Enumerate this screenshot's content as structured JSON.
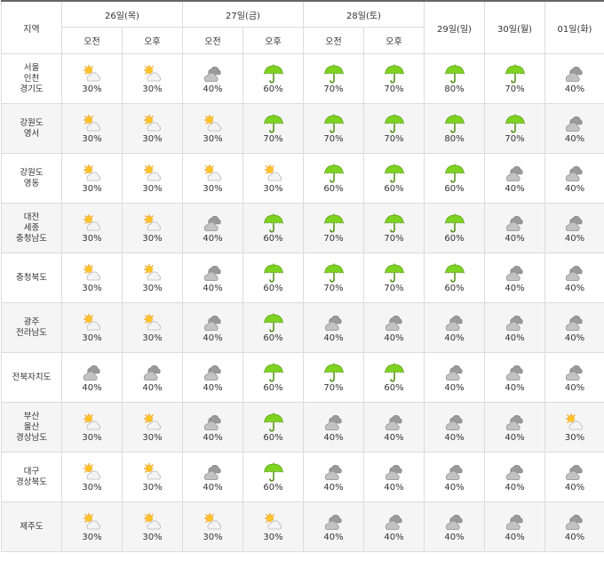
{
  "header": {
    "region_label": "지역",
    "days": [
      "26일(목)",
      "27일(금)",
      "28일(토)",
      "29일(일)",
      "30일(월)",
      "01일(화)"
    ],
    "am_label": "오전",
    "pm_label": "오후"
  },
  "icons": {
    "sunny_cloud": "partly-cloudy-icon",
    "cloudy": "cloudy-icon",
    "rain": "umbrella-rain-icon"
  },
  "rows": [
    {
      "region": [
        "서울",
        "인천",
        "경기도"
      ],
      "cells": [
        [
          "s",
          "30%"
        ],
        [
          "s",
          "30%"
        ],
        [
          "c",
          "40%"
        ],
        [
          "r",
          "60%"
        ],
        [
          "r",
          "70%"
        ],
        [
          "r",
          "70%"
        ],
        [
          "r",
          "80%"
        ],
        [
          "r",
          "70%"
        ],
        [
          "c",
          "40%"
        ]
      ]
    },
    {
      "region": [
        "강원도",
        "영서"
      ],
      "cells": [
        [
          "s",
          "30%"
        ],
        [
          "s",
          "30%"
        ],
        [
          "s",
          "30%"
        ],
        [
          "r",
          "70%"
        ],
        [
          "r",
          "70%"
        ],
        [
          "r",
          "70%"
        ],
        [
          "r",
          "80%"
        ],
        [
          "r",
          "70%"
        ],
        [
          "c",
          "40%"
        ]
      ]
    },
    {
      "region": [
        "강원도",
        "영동"
      ],
      "cells": [
        [
          "s",
          "30%"
        ],
        [
          "s",
          "30%"
        ],
        [
          "s",
          "30%"
        ],
        [
          "s",
          "30%"
        ],
        [
          "r",
          "60%"
        ],
        [
          "r",
          "60%"
        ],
        [
          "r",
          "60%"
        ],
        [
          "c",
          "40%"
        ],
        [
          "c",
          "40%"
        ]
      ]
    },
    {
      "region": [
        "대전",
        "세종",
        "충청남도"
      ],
      "cells": [
        [
          "s",
          "30%"
        ],
        [
          "s",
          "30%"
        ],
        [
          "c",
          "40%"
        ],
        [
          "r",
          "60%"
        ],
        [
          "r",
          "70%"
        ],
        [
          "r",
          "70%"
        ],
        [
          "r",
          "60%"
        ],
        [
          "c",
          "40%"
        ],
        [
          "c",
          "40%"
        ]
      ]
    },
    {
      "region": [
        "충청북도"
      ],
      "cells": [
        [
          "s",
          "30%"
        ],
        [
          "s",
          "30%"
        ],
        [
          "c",
          "40%"
        ],
        [
          "r",
          "60%"
        ],
        [
          "r",
          "70%"
        ],
        [
          "r",
          "70%"
        ],
        [
          "r",
          "60%"
        ],
        [
          "c",
          "40%"
        ],
        [
          "c",
          "40%"
        ]
      ]
    },
    {
      "region": [
        "광주",
        "전라남도"
      ],
      "cells": [
        [
          "s",
          "30%"
        ],
        [
          "s",
          "30%"
        ],
        [
          "c",
          "40%"
        ],
        [
          "r",
          "60%"
        ],
        [
          "c",
          "40%"
        ],
        [
          "c",
          "40%"
        ],
        [
          "c",
          "40%"
        ],
        [
          "c",
          "40%"
        ],
        [
          "c",
          "40%"
        ]
      ]
    },
    {
      "region": [
        "전북자치도"
      ],
      "cells": [
        [
          "c",
          "40%"
        ],
        [
          "c",
          "40%"
        ],
        [
          "c",
          "40%"
        ],
        [
          "r",
          "60%"
        ],
        [
          "r",
          "70%"
        ],
        [
          "r",
          "60%"
        ],
        [
          "c",
          "40%"
        ],
        [
          "c",
          "40%"
        ],
        [
          "c",
          "40%"
        ]
      ]
    },
    {
      "region": [
        "부산",
        "울산",
        "경상남도"
      ],
      "cells": [
        [
          "s",
          "30%"
        ],
        [
          "s",
          "30%"
        ],
        [
          "c",
          "40%"
        ],
        [
          "r",
          "60%"
        ],
        [
          "c",
          "40%"
        ],
        [
          "c",
          "40%"
        ],
        [
          "c",
          "40%"
        ],
        [
          "c",
          "40%"
        ],
        [
          "s",
          "30%"
        ]
      ]
    },
    {
      "region": [
        "대구",
        "경상북도"
      ],
      "cells": [
        [
          "s",
          "30%"
        ],
        [
          "s",
          "30%"
        ],
        [
          "c",
          "40%"
        ],
        [
          "r",
          "60%"
        ],
        [
          "c",
          "40%"
        ],
        [
          "c",
          "40%"
        ],
        [
          "c",
          "40%"
        ],
        [
          "c",
          "40%"
        ],
        [
          "c",
          "40%"
        ]
      ]
    },
    {
      "region": [
        "제주도"
      ],
      "cells": [
        [
          "s",
          "30%"
        ],
        [
          "s",
          "30%"
        ],
        [
          "s",
          "30%"
        ],
        [
          "s",
          "30%"
        ],
        [
          "c",
          "40%"
        ],
        [
          "c",
          "40%"
        ],
        [
          "c",
          "40%"
        ],
        [
          "c",
          "40%"
        ],
        [
          "c",
          "40%"
        ]
      ]
    }
  ]
}
